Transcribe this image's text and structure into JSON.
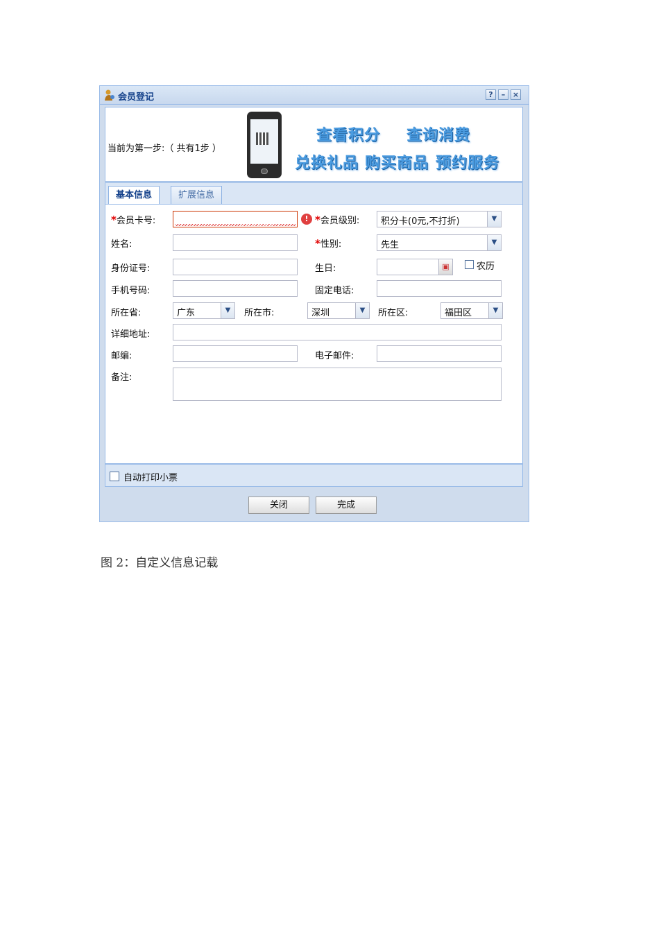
{
  "window": {
    "title": "会员登记",
    "tools": [
      "?",
      "–",
      "×"
    ]
  },
  "banner": {
    "step_text": "当前为第一步:（ 共有1步 ）",
    "promo_line1": [
      "查看积分",
      "查询消费"
    ],
    "promo_line2": [
      "兑换礼品",
      "购买商品",
      "预约服务"
    ]
  },
  "tabs": [
    {
      "label": "基本信息",
      "active": true
    },
    {
      "label": "扩展信息",
      "active": false
    }
  ],
  "form": {
    "card_no_label": "会员卡号:",
    "level_label": "会员级别:",
    "level_value": "积分卡(0元,不打折)",
    "name_label": "姓名:",
    "gender_label": "性别:",
    "gender_value": "先生",
    "id_label": "身份证号:",
    "birthday_label": "生日:",
    "lunar_label": "农历",
    "mobile_label": "手机号码:",
    "phone_label": "固定电话:",
    "province_label": "所在省:",
    "province_value": "广东",
    "city_label": "所在市:",
    "city_value": "深圳",
    "district_label": "所在区:",
    "district_value": "福田区",
    "address_label": "详细地址:",
    "zip_label": "邮编:",
    "email_label": "电子邮件:",
    "note_label": "备注:",
    "required_mark": "*",
    "error_mark": "!"
  },
  "footer": {
    "auto_print_label": "自动打印小票",
    "close_button": "关闭",
    "finish_button": "完成"
  },
  "caption": "图 2：自定义信息记载"
}
